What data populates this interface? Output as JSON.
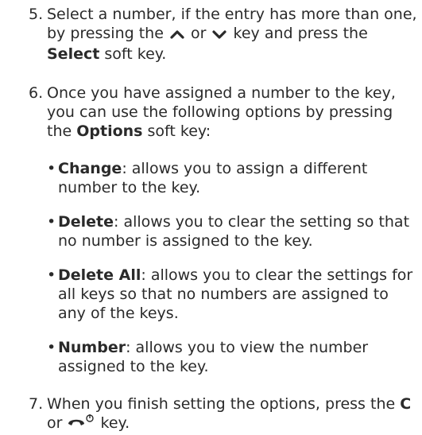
{
  "steps": [
    {
      "number": "5.",
      "text_before_up": "Select a number, if the entry has more than one, by pressing the",
      "text_or": "or",
      "text_after_down": "key and press the",
      "bold": "Select",
      "text_end": "soft key."
    },
    {
      "number": "6.",
      "text_before": "Once you have assigned a number to the key, you can use the following options by pressing the",
      "bold": "Options",
      "text_end": "soft key:"
    },
    {
      "number": "7.",
      "text_before": "When you finish setting the options, press the",
      "bold": "C",
      "text_or": "or",
      "text_end": "key."
    }
  ],
  "options": [
    {
      "name": "Change",
      "desc": ": allows you to assign a different number to the key."
    },
    {
      "name": "Delete",
      "desc": ": allows you to clear the setting so that no number is assigned to the key."
    },
    {
      "name": "Delete All",
      "desc": ": allows you to clear the settings for all keys so that no numbers are assigned to any of the keys."
    },
    {
      "name": "Number",
      "desc": ": allows you to view the number assigned to the key."
    }
  ],
  "bullet_char": "•",
  "icons": {
    "up": "chevron-up-icon",
    "down": "chevron-down-icon",
    "end": "end-call-power-icon"
  }
}
